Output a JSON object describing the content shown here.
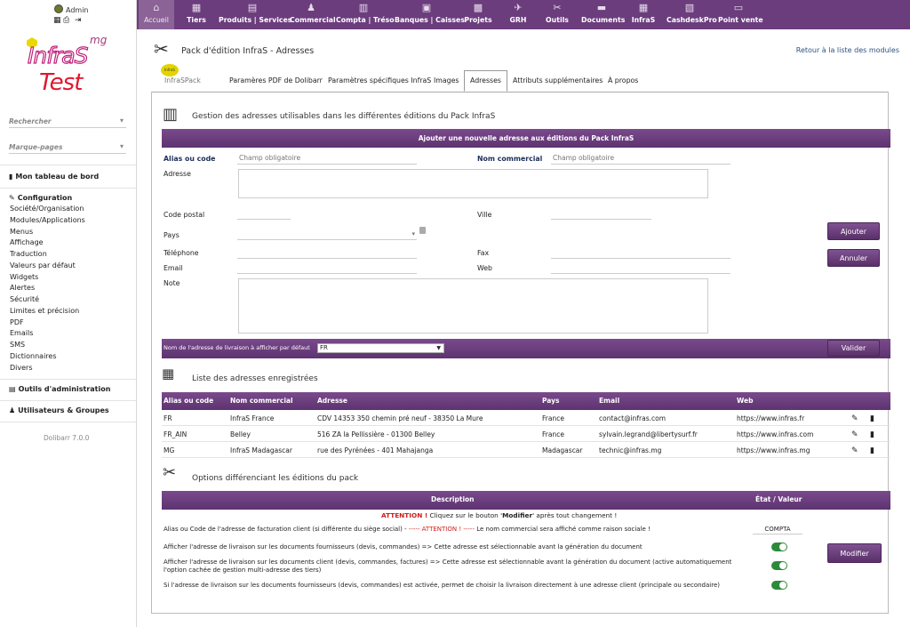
{
  "user": {
    "name": "Admin"
  },
  "logo": {
    "mg": "mg",
    "infras": "InfraS",
    "test": "Test"
  },
  "sidebar": {
    "search_label": "Rechercher",
    "bookmarks_label": "Marque-pages",
    "dashboard": "Mon tableau de bord",
    "configuration": "Configuration",
    "config_links": [
      "Société/Organisation",
      "Modules/Applications",
      "Menus",
      "Affichage",
      "Traduction",
      "Valeurs par défaut",
      "Widgets",
      "Alertes",
      "Sécurité",
      "Limites et précision",
      "PDF",
      "Emails",
      "SMS",
      "Dictionnaires",
      "Divers"
    ],
    "admin_tools": "Outils d'administration",
    "users_groups": "Utilisateurs & Groupes",
    "version": "Dolibarr 7.0.0"
  },
  "topnav": {
    "items": [
      {
        "label": "Accueil",
        "icon": "⌂"
      },
      {
        "label": "Tiers",
        "icon": "▦"
      },
      {
        "label": "Produits | Services",
        "icon": "▤"
      },
      {
        "label": "Commercial",
        "icon": "♟"
      },
      {
        "label": "Compta | Tréso",
        "icon": "▥"
      },
      {
        "label": "Banques | Caisses",
        "icon": "▣"
      },
      {
        "label": "Projets",
        "icon": "▩"
      },
      {
        "label": "GRH",
        "icon": "✈"
      },
      {
        "label": "Outils",
        "icon": "✂"
      },
      {
        "label": "Documents",
        "icon": "▬"
      },
      {
        "label": "InfraS",
        "icon": "▦"
      },
      {
        "label": "CashdeskPro",
        "icon": "▧"
      },
      {
        "label": "Point vente",
        "icon": "▭"
      }
    ]
  },
  "page": {
    "title": "Pack d'édition InfraS - Adresses",
    "back_link": "Retour à la liste des modules"
  },
  "tabs": [
    "InfraSPack",
    "Paramères PDF de Dolibarr",
    "Paramètres spécifiques InfraS",
    "Images",
    "Adresses",
    "Attributs supplémentaires",
    "À propos"
  ],
  "tabs_badge": "InfraS",
  "section1": {
    "title": "Gestion des adresses utilisables dans les différentes éditions du Pack InfraS",
    "bar": "Ajouter une nouvelle adresse aux éditions du Pack InfraS",
    "alias_label": "Alias ou code",
    "alias_placeholder": "Champ obligatoire",
    "nom_label": "Nom commercial",
    "nom_placeholder": "Champ obligatoire",
    "adresse_label": "Adresse",
    "cp_label": "Code postal",
    "ville_label": "Ville",
    "pays_label": "Pays",
    "tel_label": "Téléphone",
    "fax_label": "Fax",
    "email_label": "Email",
    "web_label": "Web",
    "note_label": "Note",
    "ajouter": "Ajouter",
    "annuler": "Annuler",
    "livraison_label": "Nom de l'adresse de livraison à afficher par défaut",
    "livraison_value": "FR",
    "valider": "Valider"
  },
  "section2": {
    "title": "Liste des adresses enregistrées",
    "headers": [
      "Alias ou code",
      "Nom commercial",
      "Adresse",
      "Pays",
      "Email",
      "Web"
    ],
    "rows": [
      {
        "alias": "FR",
        "nom": "InfraS France",
        "adresse": "CDV 14353 350 chemin pré neuf - 38350 La Mure",
        "pays": "France",
        "email": "contact@infras.com",
        "web": "https://www.infras.fr"
      },
      {
        "alias": "FR_AIN",
        "nom": "Belley",
        "adresse": "516 ZA la Pellissière - 01300 Belley",
        "pays": "France",
        "email": "sylvain.legrand@libertysurf.fr",
        "web": "https://www.infras.com"
      },
      {
        "alias": "MG",
        "nom": "InfraS Madagascar",
        "adresse": "rue des Pyrénées - 401 Mahajanga",
        "pays": "Madagascar",
        "email": "technic@infras.mg",
        "web": "https://www.infras.mg"
      }
    ]
  },
  "section3": {
    "title": "Options différenciant les éditions du pack",
    "header_desc": "Description",
    "header_state": "État / Valeur",
    "attention_prefix": "ATTENTION !",
    "attention_text": " Cliquez sur le bouton '",
    "attention_bold": "Modifier",
    "attention_suffix": "' après tout changement !",
    "opt1_a": "Alias ou Code de l'adresse de facturation client (si différente du siège social) - ",
    "opt1_b": "----- ATTENTION ! -----",
    "opt1_c": " Le nom commercial sera affiché comme raison sociale !",
    "opt1_value": "COMPTA",
    "opt2": "Afficher l'adresse de livraison sur les documents fournisseurs (devis, commandes) => Cette adresse est sélectionnable avant la génération du document",
    "opt3": "Afficher l'adresse de livraison sur les documents client (devis, commandes, factures) => Cette adresse est sélectionnable avant la génération du document (active automatiquement l'option cachée de gestion multi-adresse des tiers)",
    "opt4": "Si l'adresse de livraison sur les documents fournisseurs (devis, commandes) est activée, permet de choisir la livraison directement à une adresse client (principale ou secondaire)",
    "modifier": "Modifier"
  }
}
